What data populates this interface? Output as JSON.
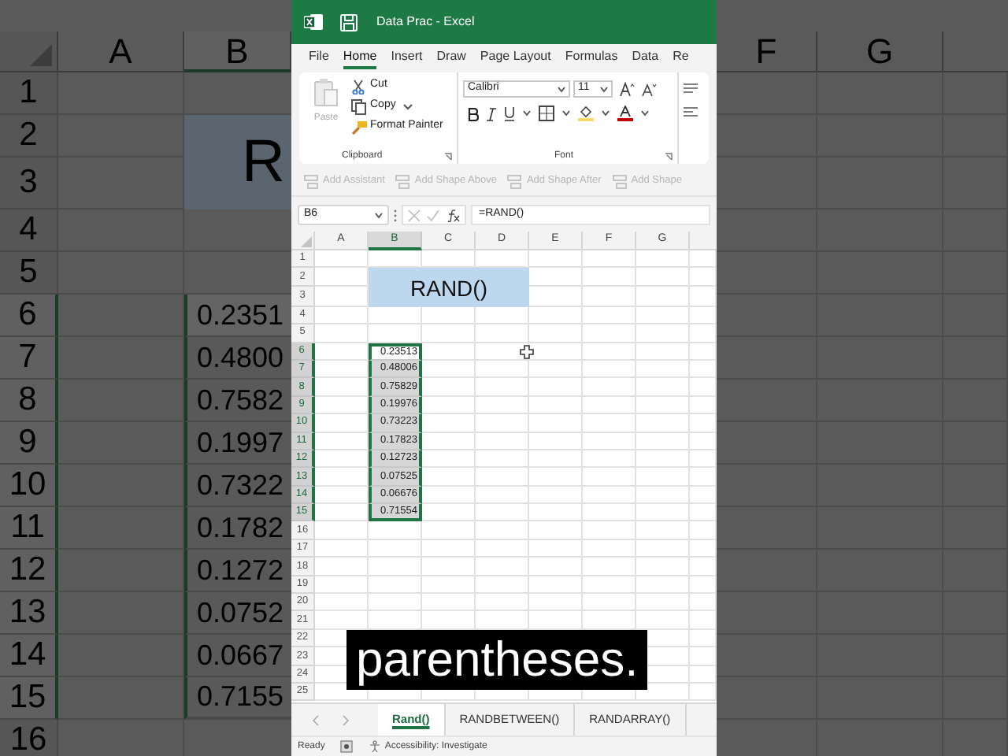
{
  "zoomed_background": {
    "left": {
      "columns": [
        "A",
        "B"
      ],
      "title_text": "R",
      "rows": [
        {
          "number": "1",
          "selected": false
        },
        {
          "number": "2",
          "selected": false
        },
        {
          "number": "3",
          "selected": false
        },
        {
          "number": "4",
          "selected": false
        },
        {
          "number": "5",
          "selected": false
        },
        {
          "number": "6",
          "value": "0.2351",
          "selected": true
        },
        {
          "number": "7",
          "value": "0.4800",
          "selected": true
        },
        {
          "number": "8",
          "value": "0.7582",
          "selected": true
        },
        {
          "number": "9",
          "value": "0.1997",
          "selected": true
        },
        {
          "number": "10",
          "value": "0.7322",
          "selected": true
        },
        {
          "number": "11",
          "value": "0.1782",
          "selected": true
        },
        {
          "number": "12",
          "value": "0.1272",
          "selected": true
        },
        {
          "number": "13",
          "value": "0.0752",
          "selected": true
        },
        {
          "number": "14",
          "value": "0.0667",
          "selected": true
        },
        {
          "number": "15",
          "value": "0.7155",
          "selected": true
        },
        {
          "number": "16",
          "selected": false
        }
      ]
    },
    "right": {
      "columns": [
        "F",
        "G"
      ]
    }
  },
  "window": {
    "title": "Data Prac - Excel"
  },
  "ribbon_tabs": [
    {
      "label": "File",
      "selected": false
    },
    {
      "label": "Home",
      "selected": true
    },
    {
      "label": "Insert",
      "selected": false
    },
    {
      "label": "Draw",
      "selected": false
    },
    {
      "label": "Page Layout",
      "selected": false
    },
    {
      "label": "Formulas",
      "selected": false
    },
    {
      "label": "Data",
      "selected": false
    },
    {
      "label": "Re",
      "selected": false
    }
  ],
  "ribbon": {
    "clipboard": {
      "label": "Clipboard",
      "paste": {
        "label": "Paste",
        "disabled": true
      },
      "items": [
        {
          "label": "Cut",
          "dropdown": false
        },
        {
          "label": "Copy",
          "dropdown": true
        },
        {
          "label": "Format Painter",
          "dropdown": false
        }
      ]
    },
    "font": {
      "label": "Font",
      "font_name": "Calibri",
      "font_size": "11"
    }
  },
  "smartart_bar": [
    {
      "label": "Add Assistant",
      "disabled": true
    },
    {
      "label": "Add Shape Above",
      "disabled": true
    },
    {
      "label": "Add Shape After",
      "disabled": true
    },
    {
      "label": "Add Shape",
      "disabled": true
    }
  ],
  "formula_bar": {
    "name_box": "B6",
    "formula": "=RAND()"
  },
  "sheet": {
    "columns": [
      "A",
      "B",
      "C",
      "D",
      "E",
      "F",
      "G"
    ],
    "title_cell": "RAND()",
    "rows": [
      {
        "number": "1",
        "selected": false
      },
      {
        "number": "2",
        "selected": false
      },
      {
        "number": "3",
        "selected": false
      },
      {
        "number": "4",
        "selected": false
      },
      {
        "number": "5",
        "selected": false
      },
      {
        "number": "6",
        "value": "0.23513",
        "selected": true
      },
      {
        "number": "7",
        "value": "0.48006",
        "selected": true
      },
      {
        "number": "8",
        "value": "0.75829",
        "selected": true
      },
      {
        "number": "9",
        "value": "0.19976",
        "selected": true
      },
      {
        "number": "10",
        "value": "0.73223",
        "selected": true
      },
      {
        "number": "11",
        "value": "0.17823",
        "selected": true
      },
      {
        "number": "12",
        "value": "0.12723",
        "selected": true
      },
      {
        "number": "13",
        "value": "0.07525",
        "selected": true
      },
      {
        "number": "14",
        "value": "0.06676",
        "selected": true
      },
      {
        "number": "15",
        "value": "0.71554",
        "selected": true
      },
      {
        "number": "16",
        "selected": false
      },
      {
        "number": "17",
        "selected": false
      },
      {
        "number": "18",
        "selected": false
      },
      {
        "number": "19",
        "selected": false
      },
      {
        "number": "20",
        "selected": false
      },
      {
        "number": "21",
        "selected": false
      },
      {
        "number": "22",
        "selected": false
      },
      {
        "number": "23",
        "selected": false
      },
      {
        "number": "24",
        "selected": false
      },
      {
        "number": "25",
        "selected": false
      }
    ]
  },
  "sheet_tabs": [
    {
      "label": "Rand()",
      "selected": true
    },
    {
      "label": "RANDBETWEEN()",
      "selected": false
    },
    {
      "label": "RANDARRAY()",
      "selected": false
    }
  ],
  "status_bar": {
    "ready": "Ready",
    "accessibility": "Accessibility: Investigate"
  },
  "caption": "parentheses."
}
